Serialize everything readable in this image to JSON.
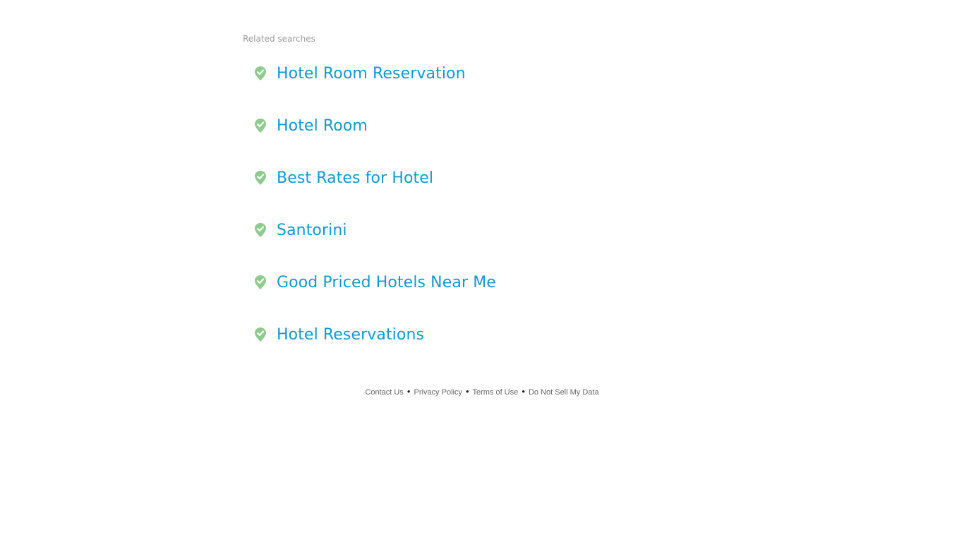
{
  "related_searches": {
    "heading": "Related searches",
    "icon": "map-pin-check-icon",
    "icon_color": "#8fcb8f",
    "link_color": "#1199cc",
    "items": [
      {
        "label": "Hotel Room Reservation"
      },
      {
        "label": "Hotel Room"
      },
      {
        "label": "Best Rates for Hotel"
      },
      {
        "label": "Santorini"
      },
      {
        "label": "Good Priced Hotels Near Me"
      },
      {
        "label": "Hotel Reservations"
      }
    ]
  },
  "footer": {
    "separator": "•",
    "links": [
      {
        "label": "Contact Us"
      },
      {
        "label": "Privacy Policy"
      },
      {
        "label": "Terms of Use"
      },
      {
        "label": "Do Not Sell My Data"
      }
    ]
  }
}
